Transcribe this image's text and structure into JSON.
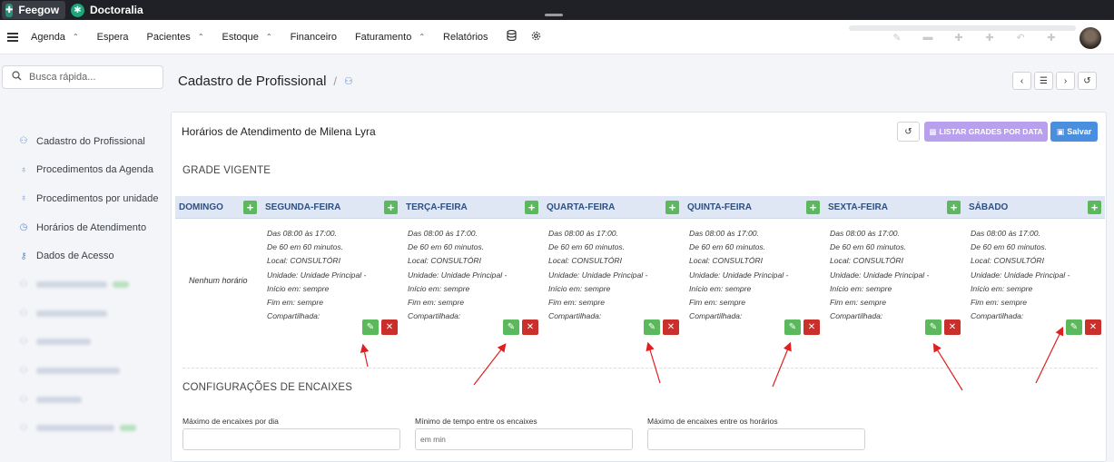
{
  "topbar": {
    "tabs": [
      "Feegow",
      "Doctoralia"
    ]
  },
  "nav": {
    "items": [
      {
        "label": "Agenda",
        "has_dropdown": true
      },
      {
        "label": "Espera",
        "has_dropdown": false
      },
      {
        "label": "Pacientes",
        "has_dropdown": true
      },
      {
        "label": "Estoque",
        "has_dropdown": true
      },
      {
        "label": "Financeiro",
        "has_dropdown": false
      },
      {
        "label": "Faturamento",
        "has_dropdown": true
      },
      {
        "label": "Relatórios",
        "has_dropdown": false
      }
    ],
    "icons": [
      "database-icon",
      "gear-icon"
    ]
  },
  "search": {
    "placeholder": "Busca rápida..."
  },
  "sidebar": {
    "items": [
      {
        "label": "Cadastro do Profissional",
        "icon": "user-icon"
      },
      {
        "label": "Procedimentos da Agenda",
        "icon": "stethoscope-icon"
      },
      {
        "label": "Procedimentos por unidade",
        "icon": "stethoscope-icon"
      },
      {
        "label": "Horários de Atendimento",
        "icon": "clock-icon"
      },
      {
        "label": "Dados de Acesso",
        "icon": "key-icon"
      }
    ]
  },
  "page": {
    "title": "Cadastro de Profissional",
    "separator": "/"
  },
  "card": {
    "title": "Horários de Atendimento de Milena Lyra",
    "listar_label": "LISTAR GRADES POR DATA",
    "salvar_label": "Salvar",
    "grade_title": "GRADE VIGENTE",
    "encaixes_title": "CONFIGURAÇÕES DE ENCAIXES"
  },
  "schedule": {
    "days": [
      "DOMINGO",
      "SEGUNDA-FEIRA",
      "TERÇA-FEIRA",
      "QUARTA-FEIRA",
      "QUINTA-FEIRA",
      "SEXTA-FEIRA",
      "SÁBADO"
    ],
    "no_hours": "Nenhum horário",
    "info_lines": [
      "Das 08:00 às 17:00.",
      "De 60 em 60 minutos.",
      "Local: CONSULTÓRI",
      "Unidade: Unidade Principal -",
      "Início em: sempre",
      "Fim em: sempre",
      "Compartilhada:"
    ]
  },
  "encaixes": {
    "fields": [
      {
        "label": "Máximo de encaixes por dia",
        "value": ""
      },
      {
        "label": "Mínimo de tempo entre os encaixes",
        "value": "em min"
      },
      {
        "label": "Máximo de encaixes entre os horários",
        "value": ""
      }
    ]
  },
  "colors": {
    "accent": "#4a8ee0",
    "add": "#5cb85c",
    "delete": "#c9302c",
    "listar": "#b8a0ee",
    "header_bg": "#dfe7f5",
    "annotation": "#e02020"
  }
}
